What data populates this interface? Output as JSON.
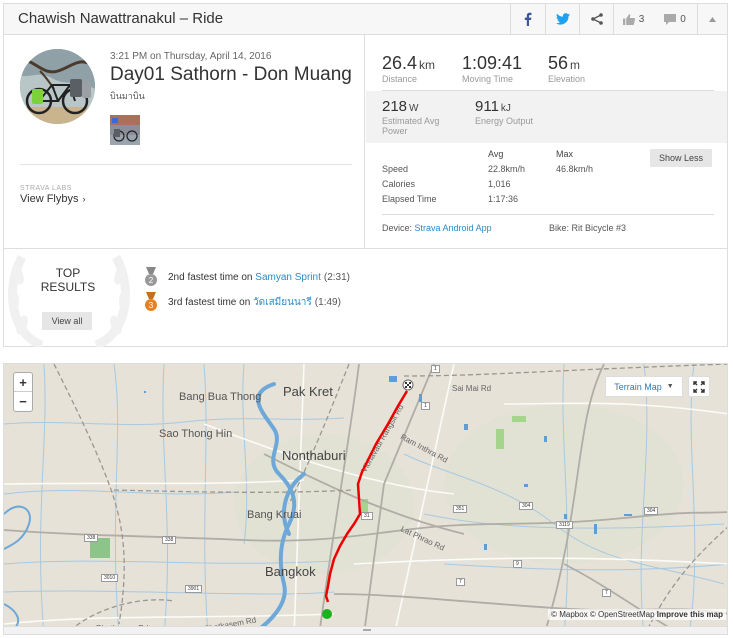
{
  "header": {
    "title": "Chawish Nawattranakul – Ride",
    "kudos_count": "3",
    "comments_count": "0"
  },
  "activity": {
    "datetime": "3:21 PM on Thursday, April 14, 2016",
    "title": "Day01 Sathorn - Don Muang",
    "description": "บินมาบิน",
    "labs_label": "STRAVA LABS",
    "flybys_label": "View Flybys"
  },
  "stats": {
    "distance": {
      "value": "26.4",
      "unit": "km",
      "label": "Distance"
    },
    "moving_time": {
      "value": "1:09:41",
      "unit": "",
      "label": "Moving Time"
    },
    "elevation": {
      "value": "56",
      "unit": "m",
      "label": "Elevation"
    },
    "power": {
      "value": "218",
      "unit": "W",
      "label": "Estimated Avg Power"
    },
    "energy": {
      "value": "911",
      "unit": "kJ",
      "label": "Energy Output"
    }
  },
  "more_stats": {
    "col_avg": "Avg",
    "col_max": "Max",
    "rows": [
      {
        "label": "Speed",
        "avg": "22.8km/h",
        "max": "46.8km/h"
      },
      {
        "label": "Calories",
        "avg": "1,016",
        "max": ""
      },
      {
        "label": "Elapsed Time",
        "avg": "1:17:36",
        "max": ""
      }
    ],
    "toggle_label": "Show Less",
    "device_label": "Device:",
    "device_value": "Strava Android App",
    "bike_label": "Bike:",
    "bike_value": "Rit Bicycle #3"
  },
  "results": {
    "heading_line1": "TOP",
    "heading_line2": "RESULTS",
    "view_all_label": "View all",
    "achievements": [
      {
        "rank": "2",
        "text": "2nd fastest time",
        "on": "on",
        "segment": "Samyan Sprint",
        "time": "(2:31)",
        "medal_color": "#999999"
      },
      {
        "rank": "3",
        "text": "3rd fastest time",
        "on": "on",
        "segment": "วัดเสมียนนารี",
        "time": "(1:49)",
        "medal_color": "#e8821e"
      }
    ]
  },
  "map": {
    "zoom_in": "+",
    "zoom_out": "−",
    "style_label": "Terrain Map",
    "attribution_mapbox": "© Mapbox",
    "attribution_osm": "© OpenStreetMap",
    "improve_label": "Improve this map",
    "route_color": "#ee0000",
    "start_color": "#1bb21b",
    "place_labels": [
      "Pak Kret",
      "Bang Bua Thong",
      "Sao Thong Hin",
      "Nonthaburi",
      "Bang Kruai",
      "Bangkok",
      "Sai Mai Rd",
      "Ram Inthra Rd",
      "Lat Phrao Rd",
      "Vibhavadi Rangsit Rd",
      "Phetkasem Rd",
      "Phetkasem Rd"
    ],
    "road_shields": [
      "1",
      "1",
      "338",
      "338",
      "3010",
      "3901",
      "351",
      "304",
      "304",
      "3119",
      "9",
      "7",
      "7",
      "31"
    ]
  }
}
